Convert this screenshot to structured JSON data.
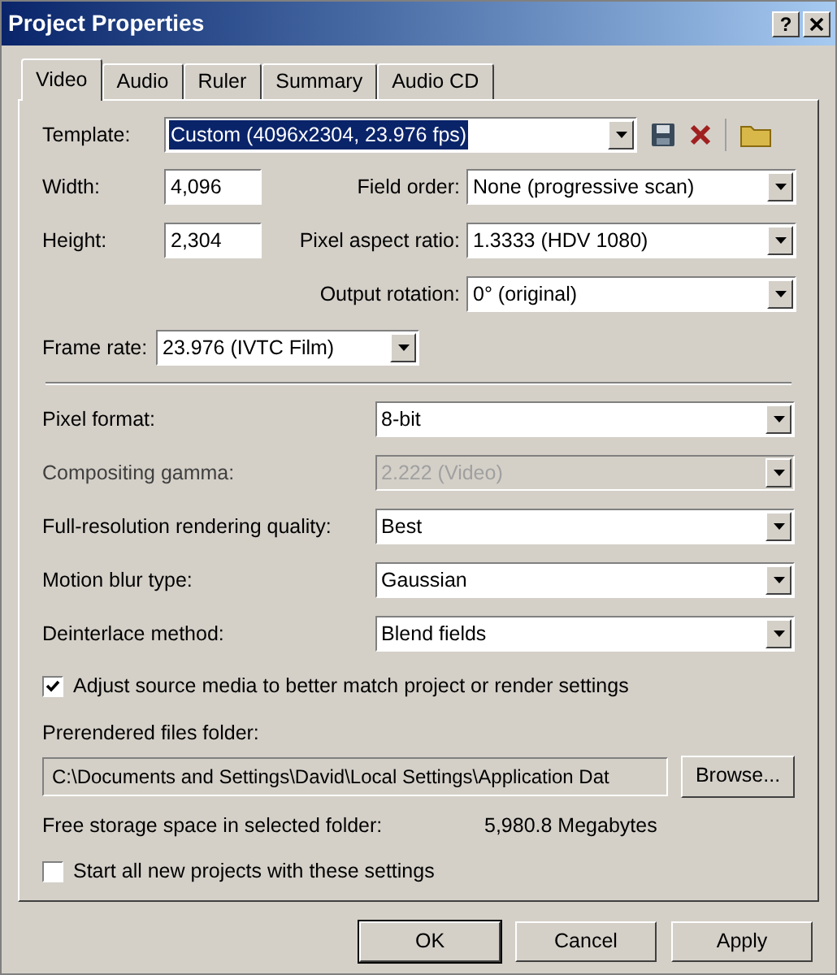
{
  "window": {
    "title": "Project Properties",
    "help_button": "?"
  },
  "tabs": [
    {
      "label": "Video",
      "selected": true
    },
    {
      "label": "Audio",
      "selected": false
    },
    {
      "label": "Ruler",
      "selected": false
    },
    {
      "label": "Summary",
      "selected": false
    },
    {
      "label": "Audio CD",
      "selected": false
    }
  ],
  "template": {
    "label": "Template:",
    "value": "Custom (4096x2304, 23.976 fps)",
    "highlighted": true
  },
  "width": {
    "label": "Width:",
    "value": "4,096"
  },
  "height": {
    "label": "Height:",
    "value": "2,304"
  },
  "field_order": {
    "label": "Field order:",
    "value": "None (progressive scan)"
  },
  "pixel_aspect_ratio": {
    "label": "Pixel aspect ratio:",
    "value": "1.3333 (HDV 1080)"
  },
  "output_rotation": {
    "label": "Output rotation:",
    "value": "0° (original)"
  },
  "frame_rate": {
    "label": "Frame rate:",
    "value": "23.976 (IVTC Film)"
  },
  "settings": [
    {
      "label": "Pixel format:",
      "value": "8-bit",
      "disabled": false
    },
    {
      "label": "Compositing gamma:",
      "value": "2.222 (Video)",
      "disabled": true
    },
    {
      "label": "Full-resolution rendering quality:",
      "value": "Best",
      "disabled": false
    },
    {
      "label": "Motion blur type:",
      "value": "Gaussian",
      "disabled": false
    },
    {
      "label": "Deinterlace method:",
      "value": "Blend fields",
      "disabled": false
    }
  ],
  "adjust_source_media": {
    "label": "Adjust source media to better match project or render settings",
    "checked": true
  },
  "prerendered_folder": {
    "label": "Prerendered files folder:",
    "value": "C:\\Documents and Settings\\David\\Local Settings\\Application Dat",
    "browse_button": "Browse..."
  },
  "free_storage": {
    "label": "Free storage space in selected folder:",
    "value": "5,980.8 Megabytes"
  },
  "start_all_new_projects": {
    "label": "Start all new projects with these settings",
    "checked": false
  },
  "buttons": [
    "OK",
    "Cancel",
    "Apply"
  ]
}
